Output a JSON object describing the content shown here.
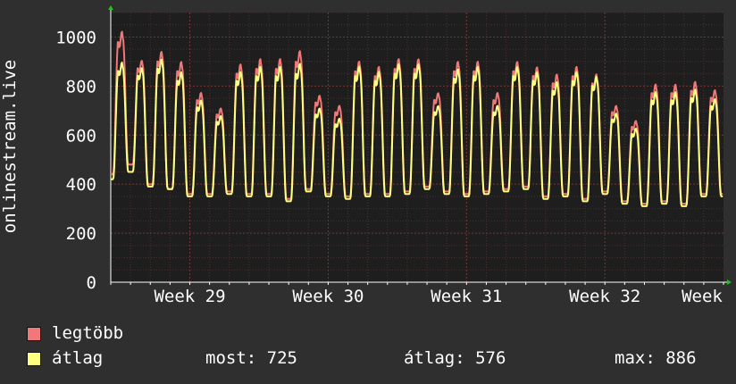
{
  "chart_data": {
    "type": "line",
    "ylabel": "onlinestream.live",
    "ylim": [
      0,
      1100
    ],
    "yticks": [
      0,
      200,
      400,
      600,
      800,
      1000
    ],
    "xticks": [
      "Week 29",
      "Week 30",
      "Week 31",
      "Week 32",
      "Week"
    ],
    "grid": true,
    "colors": {
      "background": "#2f2f2f",
      "plot": "#1e1e1e",
      "grid_minor": "#5a3030",
      "grid_major": "#6a2a2a",
      "max": "#f07878",
      "avg": "#ffff80"
    },
    "days": 31,
    "series": [
      {
        "name": "legtöbb",
        "daily_min": [
          440,
          480,
          400,
          380,
          360,
          360,
          370,
          360,
          360,
          340,
          380,
          360,
          350,
          360,
          360,
          370,
          390,
          370,
          360,
          370,
          380,
          390,
          350,
          360,
          340,
          370,
          330,
          320,
          330,
          320,
          360
        ],
        "daily_peak": [
          990,
          880,
          910,
          870,
          750,
          690,
          860,
          880,
          880,
          910,
          740,
          700,
          870,
          850,
          880,
          880,
          750,
          870,
          870,
          750,
          870,
          850,
          820,
          850,
          820,
          700,
          640,
          780,
          780,
          790,
          760
        ]
      },
      {
        "name": "átlag",
        "daily_min": [
          420,
          450,
          390,
          380,
          350,
          350,
          360,
          350,
          350,
          330,
          370,
          350,
          340,
          350,
          350,
          360,
          380,
          360,
          350,
          360,
          370,
          380,
          340,
          350,
          330,
          360,
          320,
          310,
          320,
          310,
          350
        ],
        "daily_peak": [
          870,
          850,
          880,
          830,
          720,
          660,
          830,
          850,
          850,
          860,
          690,
          650,
          850,
          830,
          860,
          860,
          700,
          840,
          850,
          700,
          850,
          830,
          790,
          830,
          810,
          670,
          610,
          750,
          750,
          760,
          725
        ]
      }
    ]
  },
  "legend": {
    "max_label": "legtöbb",
    "avg_label": "átlag",
    "most": "most: 725",
    "atlag": "átlag: 576",
    "max": "max: 886"
  }
}
